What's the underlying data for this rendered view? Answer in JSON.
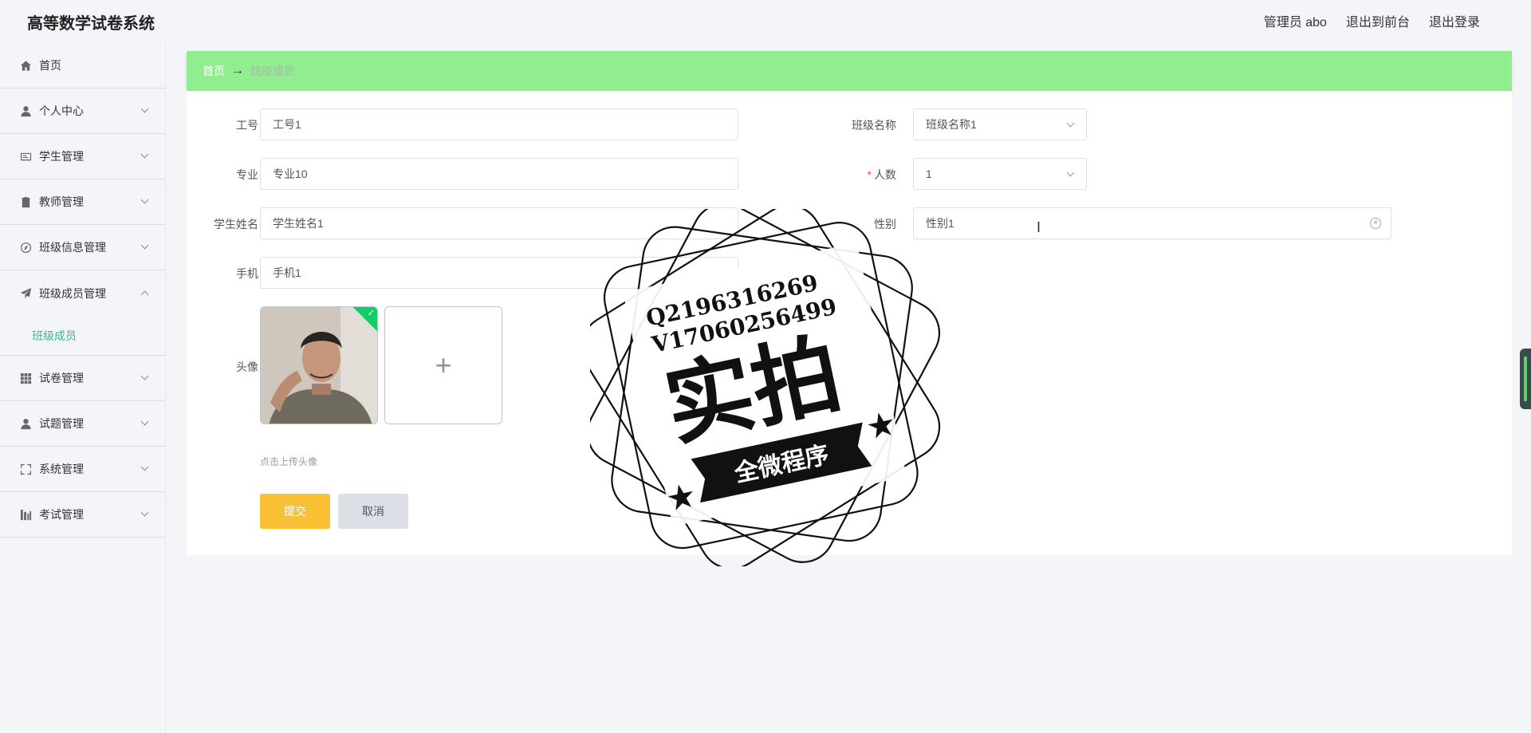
{
  "app": {
    "title": "高等数学试卷系统"
  },
  "header": {
    "links": [
      "管理员 abo",
      "退出到前台",
      "退出登录"
    ]
  },
  "sidebar": {
    "items": [
      {
        "label": "首页",
        "icon": "home-icon",
        "has_arrow": false
      },
      {
        "label": "个人中心",
        "icon": "user-icon",
        "has_arrow": true
      },
      {
        "label": "学生管理",
        "icon": "id-card-icon",
        "has_arrow": true
      },
      {
        "label": "教师管理",
        "icon": "clipboard-icon",
        "has_arrow": true
      },
      {
        "label": "班级信息管理",
        "icon": "compass-icon",
        "has_arrow": true
      },
      {
        "label": "班级成员管理",
        "icon": "send-icon",
        "has_arrow": true,
        "expanded": true,
        "children": [
          "班级成员"
        ]
      },
      {
        "label": "试卷管理",
        "icon": "grid-icon",
        "has_arrow": true
      },
      {
        "label": "试题管理",
        "icon": "user-icon",
        "has_arrow": true
      },
      {
        "label": "系统管理",
        "icon": "frame-icon",
        "has_arrow": true
      },
      {
        "label": "考试管理",
        "icon": "chart-icon",
        "has_arrow": true
      }
    ]
  },
  "breadcrumb": {
    "home": "首页",
    "separator": "→",
    "current": "班级成员"
  },
  "form": {
    "gonghao": {
      "label": "工号",
      "value": "工号1"
    },
    "zhuanye": {
      "label": "专业",
      "value": "专业10"
    },
    "xueshengxingming": {
      "label": "学生姓名",
      "value": "学生姓名1"
    },
    "shouji": {
      "label": "手机",
      "value": "手机1"
    },
    "touxiang": {
      "label": "头像",
      "tip": "点击上传头像"
    },
    "banjimingcheng": {
      "label": "班级名称",
      "value": "班级名称1"
    },
    "renshu": {
      "label": "人数",
      "required_mark": "*",
      "value": "1"
    },
    "xingbie": {
      "label": "性别",
      "value": "性别1"
    }
  },
  "buttons": {
    "submit": "提交",
    "cancel": "取消"
  },
  "watermark": {
    "line1": "Q2196316269",
    "line2": "V17060256499",
    "big": "实拍",
    "ribbon": "全微程序"
  },
  "colors": {
    "breadcrumb_bg": "#90ee90",
    "submit_bg": "#f9c133",
    "active_submenu": "#3cb49c"
  }
}
